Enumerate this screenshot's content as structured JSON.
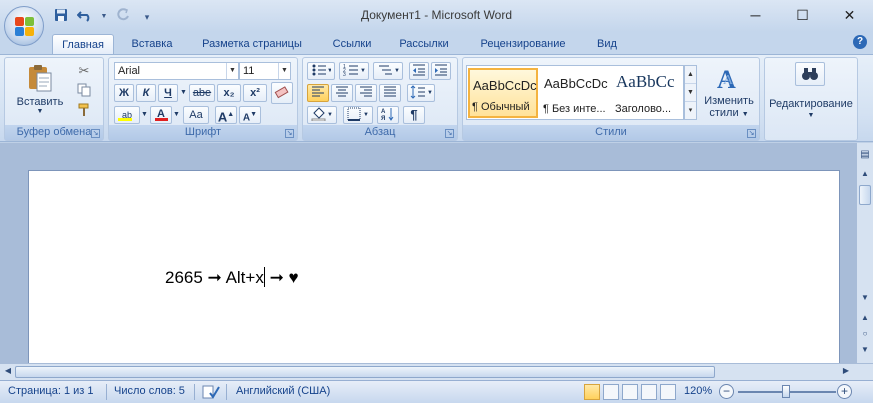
{
  "window": {
    "title": "Документ1 - Microsoft Word"
  },
  "qat": {
    "icons": [
      "save-icon",
      "undo-icon",
      "redo-icon",
      "customize-icon"
    ]
  },
  "tabs": [
    {
      "label": "Главная",
      "active": true
    },
    {
      "label": "Вставка"
    },
    {
      "label": "Разметка страницы"
    },
    {
      "label": "Ссылки"
    },
    {
      "label": "Рассылки"
    },
    {
      "label": "Рецензирование"
    },
    {
      "label": "Вид"
    }
  ],
  "ribbon": {
    "clipboard": {
      "label": "Буфер обмена",
      "paste_label": "Вставить"
    },
    "font": {
      "label": "Шрифт",
      "font_name": "Arial",
      "font_size": "11",
      "bold": "Ж",
      "italic": "К",
      "underline": "Ч",
      "strike": "abe",
      "subscript": "x₂",
      "superscript": "x²",
      "grow": "A",
      "shrink": "A",
      "case": "Aa",
      "highlight": "ab",
      "fontcolor": "A"
    },
    "paragraph": {
      "label": "Абзац",
      "pilcrow": "¶"
    },
    "styles": {
      "label": "Стили",
      "items": [
        {
          "sample": "AaBbCcDc",
          "name": "¶ Обычный"
        },
        {
          "sample": "AaBbCcDc",
          "name": "¶ Без инте..."
        },
        {
          "sample": "AaBbCc",
          "name": "Заголово..."
        }
      ],
      "change_label_1": "Изменить",
      "change_label_2": "стили"
    },
    "editing": {
      "label": "Редактирование"
    }
  },
  "document": {
    "text": "2665 ➞ Alt+x",
    "after_caret": " ➞ ♥"
  },
  "status": {
    "page": "Страница: 1 из 1",
    "words": "Число слов: 5",
    "language": "Английский (США)",
    "zoom": "120%"
  },
  "colors": {
    "accent": "#15428b",
    "highlight": "#ffff00",
    "fontcolor": "#e02020"
  }
}
